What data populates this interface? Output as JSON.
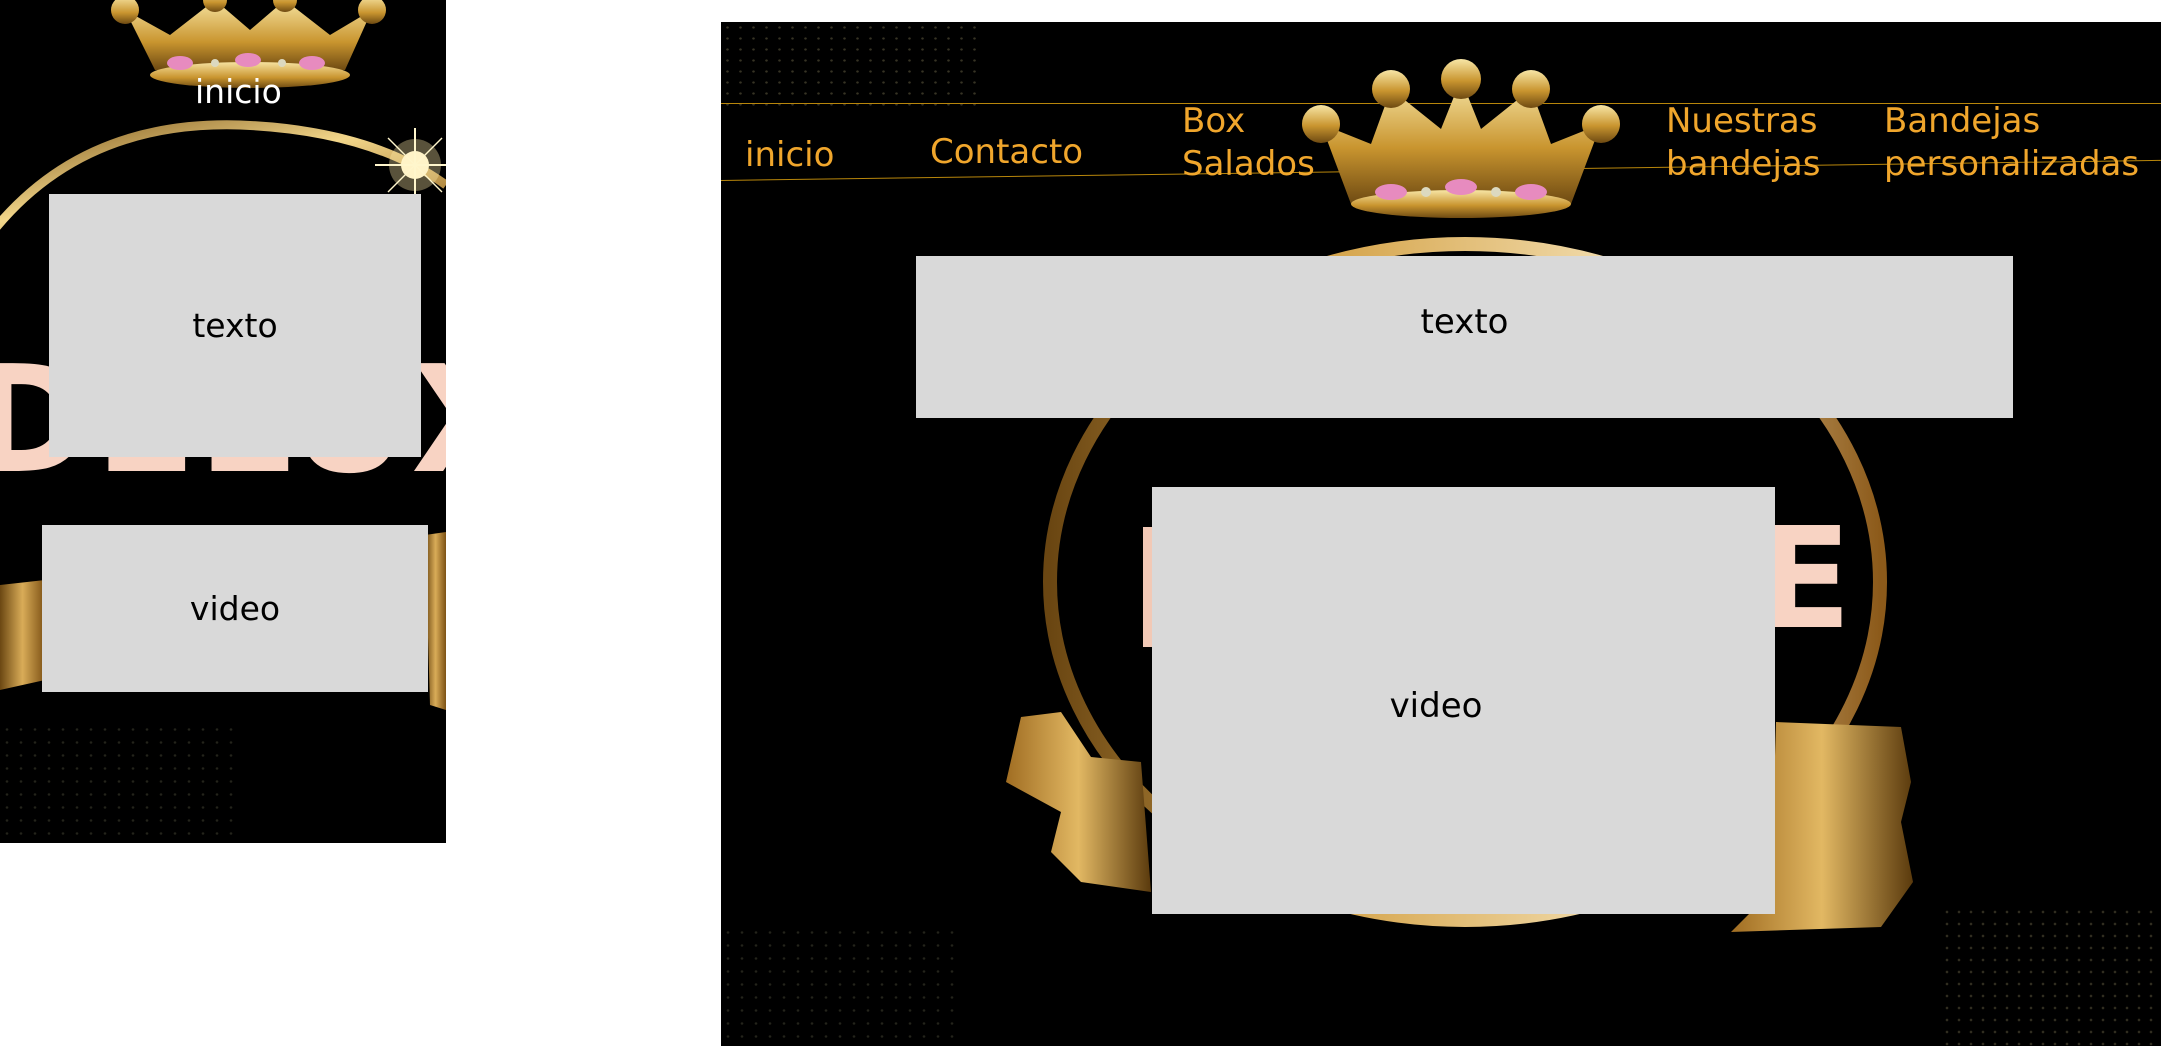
{
  "mobile": {
    "nav_label": "inicio",
    "text_block": "texto",
    "video_block": "video",
    "brand_word": "DELUX"
  },
  "desktop": {
    "nav": {
      "inicio": "inicio",
      "contacto": "Contacto",
      "box_salados": "Box\nSalados",
      "nuestras_bandejas": "Nuestras\nbandejas",
      "bandejas_personalizadas": "Bandejas\npersonalizadas"
    },
    "text_block": "texto",
    "video_block": "video",
    "brand_word": "E"
  },
  "colors": {
    "background": "#000000",
    "nav_text": "#f0a62c",
    "nav_line": "#b8860b",
    "placeholder": "#d9d9d9",
    "gold": "#c99a3a",
    "brand_pink": "#f8d3c3"
  },
  "icons": {
    "crown": "crown-logo-icon",
    "ring": "gold-ring-icon",
    "ribbon": "gold-ribbon-icon",
    "flare": "light-flare-icon"
  }
}
